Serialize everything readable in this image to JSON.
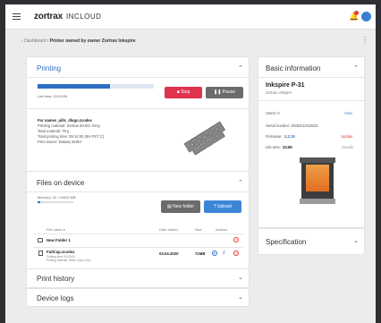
{
  "header": {
    "brand": "zortrax",
    "brand_suffix": "INCLOUD"
  },
  "breadcrumb": {
    "root": "Dashboard",
    "separator": "/",
    "current": "Printer owned by owner Zortrax Inkspire"
  },
  "printing": {
    "title": "Printing",
    "progress_fraction": 0.62,
    "time_left": "Left time: 03:09:55",
    "stop_label": "Stop",
    "pause_label": "Pause",
    "file_line": "For names_pills_dlugo.zcodex",
    "material_line": "Printing material: Zortrax BASIC Grey",
    "total_material": "Total material: 79 g",
    "total_time": "Total printing time: 09:14:00 (9H PST C)",
    "print_owner": "Print owner: Dalwey Boller"
  },
  "files": {
    "title": "Files on device",
    "memory": "Memory: 41 / 15002 MB",
    "new_folder_label": "New folder",
    "upload_label": "Upload",
    "columns": {
      "name": "File name ▾",
      "date": "Date added",
      "size": "Size",
      "actions": "Actions"
    },
    "rows": [
      {
        "name": "New Folder 1",
        "sub1": "",
        "sub2": "",
        "date": "",
        "size": ""
      },
      {
        "name": "FullCap.zcodex",
        "sub1": "Printing time: 05:00:00",
        "sub2": "Printing material: Resin Clear Grey",
        "date": "03.04.2020",
        "size": "71MB"
      }
    ]
  },
  "print_history": {
    "title": "Print history"
  },
  "device_logs": {
    "title": "Device logs"
  },
  "basic_info": {
    "title": "Basic information",
    "model": "Inkspire P-31",
    "maker": "Zortrax Inkspire",
    "users_label": "Users: 0",
    "users_action": "View",
    "serial": "Serial number: ZN38312G2633",
    "firmware_label": "Firmware:",
    "firmware_value": "2.2.15",
    "firmware_action": "Update",
    "lifetime_label": "Life time:",
    "lifetime_value": "34:86",
    "lifetime_action": "Details"
  },
  "specification": {
    "title": "Specification"
  },
  "colors": {
    "accent": "#2e6fc2",
    "stop": "#e0334f",
    "upload": "#3d86d6",
    "pause": "#6b6b6b",
    "danger": "#e53935"
  }
}
